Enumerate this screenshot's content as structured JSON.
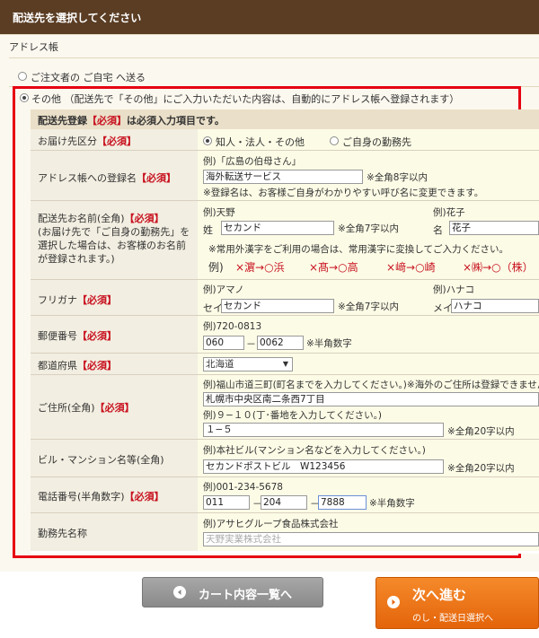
{
  "header": {
    "title": "配送先を選択してください"
  },
  "address_book": {
    "section_title": "アドレス帳",
    "option_home": "ご注文者の ご自宅 へ送る",
    "option_other": "その他 （配送先で「その他」にご入力いただいた内容は、自動的にアドレス帳へ登録されます）"
  },
  "form": {
    "title_pre": "配送先登録",
    "title_req": "【必須】",
    "title_post": "は必須入力項目です。",
    "req_tag": "【必須】",
    "delivery_type": {
      "label": "お届け先区分",
      "options": [
        "知人・法人・その他",
        "ご自身の勤務先"
      ]
    },
    "address_book_name": {
      "label": "アドレス帳への登録名",
      "example": "例)「広島の伯母さん」",
      "value": "海外転送サービス",
      "limit": "※全角8字以内",
      "hint": "※登録名は、お客様ご自身がわかりやすい呼び名に変更できます。"
    },
    "full_name": {
      "label": "配送先お名前(全角)",
      "sub": "(お届け先で「ご自身の勤務先」を選択した場合は、お客様のお名前が登録されます。)",
      "ex_last": "例)天野",
      "ex_first": "例)花子",
      "last_label": "姓",
      "first_label": "名",
      "last_value": "セカンド",
      "first_value": "花子",
      "limit": "※全角7字以内",
      "kanji_note": "※常用外漢字をご利用の場合は、常用漢字に変換してご入力ください。",
      "kanji_ex_label": "例)",
      "kanji_examples": [
        "×濵→○浜",
        "×髙→○高",
        "×﨑→○崎",
        "×㈱→○（株）"
      ]
    },
    "furigana": {
      "label": "フリガナ",
      "ex_last": "例)アマノ",
      "ex_first": "例)ハナコ",
      "last_label": "セイ",
      "first_label": "メイ",
      "last_value": "セカンド",
      "first_value": "ハナコ",
      "limit": "※全角7字以内"
    },
    "postal": {
      "label": "郵便番号",
      "example": "例)720-0813",
      "v1": "060",
      "v2": "0062",
      "dash": "－",
      "note": "※半角数字"
    },
    "prefecture": {
      "label": "都道府県",
      "value": "北海道"
    },
    "address": {
      "label": "ご住所(全角)",
      "ex1": "例)福山市道三町(町名までを入力してください。)※海外のご住所は登録できません",
      "v1": "札幌市中央区南二条西7丁目",
      "ex2": "例)９−１０(丁･番地を入力してください。)",
      "v2": "１−５",
      "limit": "※全角20字以内"
    },
    "building": {
      "label": "ビル・マンション名等(全角)",
      "example": "例)本社ビル(マンション名などを入力してください。)",
      "value": "セカンドポストビル　W123456",
      "limit": "※全角20字以内"
    },
    "phone": {
      "label": "電話番号(半角数字)",
      "example": "例)001-234-5678",
      "v1": "011",
      "v2": "204",
      "v3": "7888",
      "dash": "－",
      "note": "※半角数字"
    },
    "company": {
      "label": "勤務先名称",
      "example": "例)アサヒグループ食品株式会社",
      "placeholder": "天野実業株式会社"
    }
  },
  "buttons": {
    "back": "カート内容一覧へ",
    "next": "次へ進む",
    "next_sub": "のし・配送日選択へ"
  },
  "colors": {
    "header_bg": "#5a3d23",
    "highlight": "#e60012",
    "next_button": "#f07a1c"
  }
}
